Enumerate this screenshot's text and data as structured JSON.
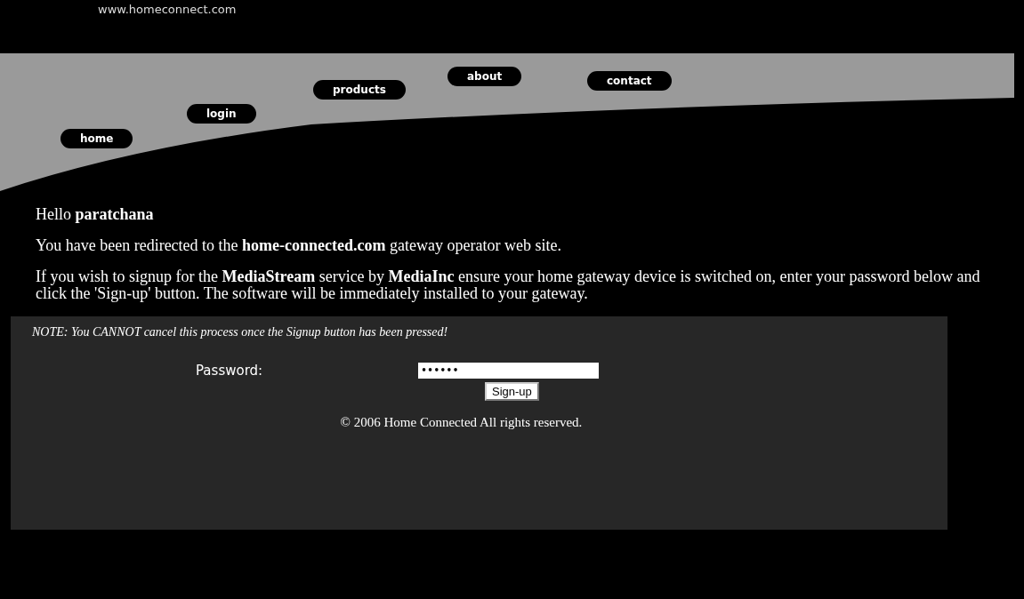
{
  "site": {
    "url": "www.homeconnect.com"
  },
  "nav": [
    {
      "label": "home"
    },
    {
      "label": "login"
    },
    {
      "label": "products"
    },
    {
      "label": "about"
    },
    {
      "label": "contact"
    }
  ],
  "greeting": "Hello **paratchana**",
  "paragraphs": [
    "You have been redirected to the **home-connected.com** gateway operator web site.",
    "If you wish to signup for the **MediaStream** service by **MediaInc** ensure your home gateway device is switched on, enter your password below and click the 'Sign-up' button. The software will be immediately installed to your gateway."
  ],
  "form": {
    "note": "NOTE: You CANNOT cancel this process once the Signup button has been pressed!",
    "password_label": "Password:",
    "password_value": "••••••",
    "button": "Sign-up"
  },
  "footer": "© 2006 Home Connected All rights reserved."
}
